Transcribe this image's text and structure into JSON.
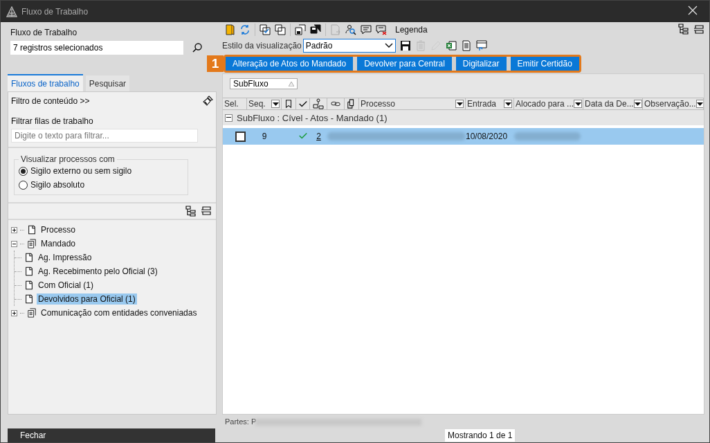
{
  "window": {
    "title": "Fluxo de Trabalho"
  },
  "sidebar": {
    "label": "Fluxo de Trabalho",
    "field_value": "7 registros selecionados",
    "tabs": [
      {
        "label": "Fluxos de trabalho",
        "selected": true
      },
      {
        "label": "Pesquisar",
        "selected": false
      }
    ],
    "filter_toggle": "Filtro de conteúdo >>",
    "filter_label": "Filtrar filas de trabalho",
    "filter_placeholder": "Digite o texto para filtrar...",
    "visibility": {
      "legend": "Visualizar processos com",
      "options": [
        {
          "label": "Sigilo externo ou sem sigilo",
          "selected": true
        },
        {
          "label": "Sigilo absoluto",
          "selected": false
        }
      ]
    },
    "tree": [
      {
        "label": "Processo",
        "kind": "document",
        "expanded": false,
        "selected": false
      },
      {
        "label": "Mandado",
        "kind": "stack",
        "expanded": true,
        "selected": false,
        "children": [
          {
            "label": "Ag. Impressão",
            "kind": "document",
            "selected": false
          },
          {
            "label": "Ag. Recebimento pelo Oficial (3)",
            "kind": "document",
            "selected": false
          },
          {
            "label": "Com Oficial (1)",
            "kind": "document",
            "selected": false
          },
          {
            "label": "Devolvidos para Oficial (1)",
            "kind": "document",
            "selected": true
          }
        ]
      },
      {
        "label": "Comunicação com entidades conveniadas",
        "kind": "stack",
        "expanded": false,
        "selected": false
      }
    ],
    "close_button": "Fechar"
  },
  "toolbar": {
    "legend": "Legenda",
    "style_label": "Estilo da visualização",
    "style_value": "Padrão"
  },
  "actions": {
    "badge": "1",
    "buttons": [
      "Alteração de Atos do Mandado",
      "Devolver para Central",
      "Digitalizar",
      "Emitir Certidão"
    ]
  },
  "grid": {
    "group_by": "SubFluxo",
    "columns": [
      {
        "kind": "text",
        "label": "Sel.",
        "filter": false
      },
      {
        "kind": "text",
        "label": "Seq.",
        "filter": true
      },
      {
        "kind": "icon"
      },
      {
        "kind": "icon"
      },
      {
        "kind": "icon"
      },
      {
        "kind": "icon"
      },
      {
        "kind": "icon"
      },
      {
        "kind": "text",
        "label": "Processo",
        "filter": true
      },
      {
        "kind": "text",
        "label": "Entrada",
        "filter": true
      },
      {
        "kind": "text",
        "label": "Alocado para ...",
        "filter": true
      },
      {
        "kind": "text",
        "label": "Data da De...",
        "filter": true
      },
      {
        "kind": "text",
        "label": "Observação...",
        "filter": true
      }
    ],
    "group": {
      "label": "SubFluxo : Cível - Atos - Mandado  (1)",
      "expanded": true
    },
    "rows": [
      {
        "selected": true,
        "checked": false,
        "seq": "9",
        "confirmed": true,
        "link": "2",
        "entrada": "10/08/2020"
      }
    ]
  },
  "footer": {
    "parties": "Partes: P",
    "status": "Mostrando 1 de 1"
  }
}
